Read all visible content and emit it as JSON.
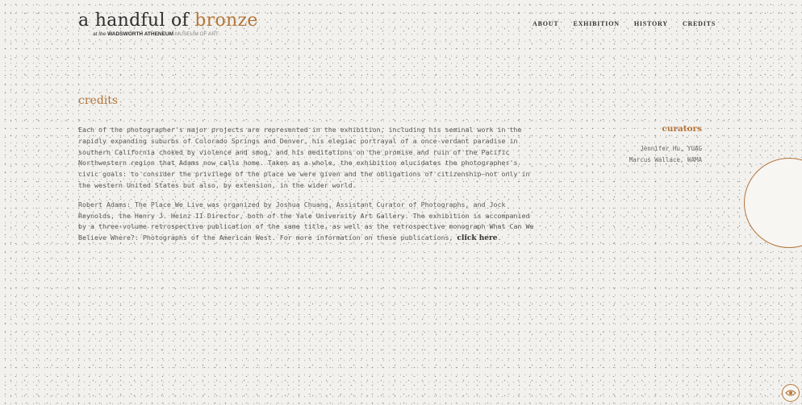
{
  "header": {
    "logo": {
      "title_a": "a handful of ",
      "title_b": "bronze",
      "sub_prefix": "at the ",
      "sub_bold": "WADSWORTH ATHENEUM",
      "sub_light": " MUSEUM OF ART"
    },
    "nav": [
      {
        "label": "ABOUT"
      },
      {
        "label": "EXHIBITION"
      },
      {
        "label": "HISTORY"
      },
      {
        "label": "CREDITS"
      }
    ]
  },
  "page": {
    "title": "credits",
    "paragraph1": "Each of the photographer's major projects are represented in the exhibition, including his seminal work in the rapidly expanding suburbs of Colorado Springs and Denver, his elegiac portrayal of a once-verdant paradise in southern California choked by violence and smog, and his meditations on the promise and ruin of the Pacific Northwestern region that Adams now calls home. Taken as a whole, the exhibition elucidates the photographer's civic goals: to consider the privilege of the place we were given and the obligations of citizenship—not only in the western United States but also, by extension, in the wider world.",
    "paragraph2_text": "Robert Adams: The Place We Live was organized by Joshua Chuang, Assistant Curator of Photographs, and Jock Reynolds, the Henry J. Heinz II Director, both of the Yale University Art Gallery. The exhibition is accompanied by a three-volume retrospective publication of the same title, as well as the retrospective monograph What Can We Believe Where?: Photographs of the American West. For more information on these publications, ",
    "paragraph2_link": "click here",
    "paragraph2_end": "."
  },
  "curators": {
    "title": "curators",
    "names": [
      "Jennifer Hu, YUAG",
      "Marcus Wallace, WAMA"
    ]
  },
  "colors": {
    "accent": "#b5763a",
    "background": "#f2f1ee",
    "text": "#555555"
  },
  "icons": {
    "view_toggle": "eye-icon"
  }
}
